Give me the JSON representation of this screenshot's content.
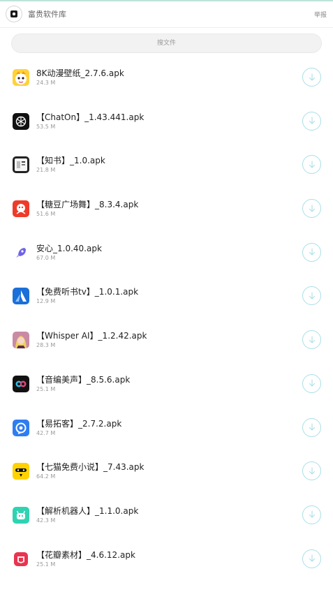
{
  "header": {
    "app_name": "富贵软件库",
    "report_label": "举报",
    "logo_icon": "app-logo-icon"
  },
  "search": {
    "placeholder": "搜文件"
  },
  "accent_color": "#a9dfe7",
  "files": [
    {
      "name": "8K动漫壁纸_2.7.6.apk",
      "size": "24.3 M",
      "icon": "anime-wallpaper-icon"
    },
    {
      "name": "【ChatOn】_1.43.441.apk",
      "size": "53.5 M",
      "icon": "chaton-icon"
    },
    {
      "name": "【知书】_1.0.apk",
      "size": "21.8 M",
      "icon": "zhishu-icon"
    },
    {
      "name": "【糖豆广场舞】_8.3.4.apk",
      "size": "51.6 M",
      "icon": "tangdou-icon"
    },
    {
      "name": "安心_1.0.40.apk",
      "size": "67.0 M",
      "icon": "rocket-icon"
    },
    {
      "name": "【免费听书tv】_1.0.1.apk",
      "size": "12.9 M",
      "icon": "audiobook-tv-icon"
    },
    {
      "name": "【Whisper AI】_1.2.42.apk",
      "size": "28.3 M",
      "icon": "whisper-ai-icon"
    },
    {
      "name": "【音编美声】_8.5.6.apk",
      "size": "25.1 M",
      "icon": "voice-editor-icon"
    },
    {
      "name": "【易拓客】_2.7.2.apk",
      "size": "42.7 M",
      "icon": "yituoke-icon"
    },
    {
      "name": "【七猫免费小说】_7.43.apk",
      "size": "64.2 M",
      "icon": "qimao-icon"
    },
    {
      "name": "【解析机器人】_1.1.0.apk",
      "size": "42.3 M",
      "icon": "robot-icon"
    },
    {
      "name": "【花瓣素材】_4.6.12.apk",
      "size": "25.1 M",
      "icon": "huaban-icon"
    }
  ]
}
